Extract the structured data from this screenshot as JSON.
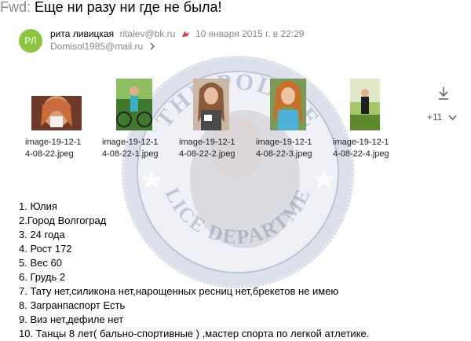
{
  "subject": {
    "prefix": "Fwd",
    "separator": ":",
    "title": "Еще ни разу ни где не была!"
  },
  "sender": {
    "avatar_initials": "РЛ",
    "name": "рита ливицкая",
    "email": "ritalev@bk.ru",
    "date": "10 января 2015 г. в 22:29",
    "flag_icon": "important-flag-icon"
  },
  "recipient": {
    "email": "Domisol1985@mail.ru",
    "expand_icon": "chevron-right-icon"
  },
  "attachments": [
    {
      "name_line1": "image-19-12-1",
      "name_line2": "4-08-22.jpeg"
    },
    {
      "name_line1": "image-19-12-1",
      "name_line2": "4-08-22-1.jpeg"
    },
    {
      "name_line1": "image-19-12-1",
      "name_line2": "4-08-22-2.jpeg"
    },
    {
      "name_line1": "image-19-12-1",
      "name_line2": "4-08-22-3.jpeg"
    },
    {
      "name_line1": "image-19-12-1",
      "name_line2": "4-08-22-4.jpeg"
    }
  ],
  "attachments_more": {
    "count_label": "+11",
    "download_icon": "download-icon",
    "expand_icon": "chevron-down-icon"
  },
  "watermark": {
    "top_text": "THE POLICE",
    "bottom_text": "POLICE DEPARTMENT"
  },
  "body_lines": [
    "1. Юлия",
    "2.Город Волгоград",
    "3. 24 года",
    "4. Рост 172",
    "5. Вес 60",
    "6. Грудь 2",
    "7. Тату нет,силикона нет,нарощенных ресниц нет,брекетов не имею",
    "8. Загранпаспорт Есть",
    "9. Виз нет,дефиле нет",
    "10. Танцы 8 лет( бально-спортивные ) ,мастер спорта по легкой атлетике."
  ],
  "colors": {
    "avatar": "#8cc63f",
    "flag": "#e8322c",
    "muted": "#8a8a8a",
    "watermark": "#1f3f7a"
  }
}
